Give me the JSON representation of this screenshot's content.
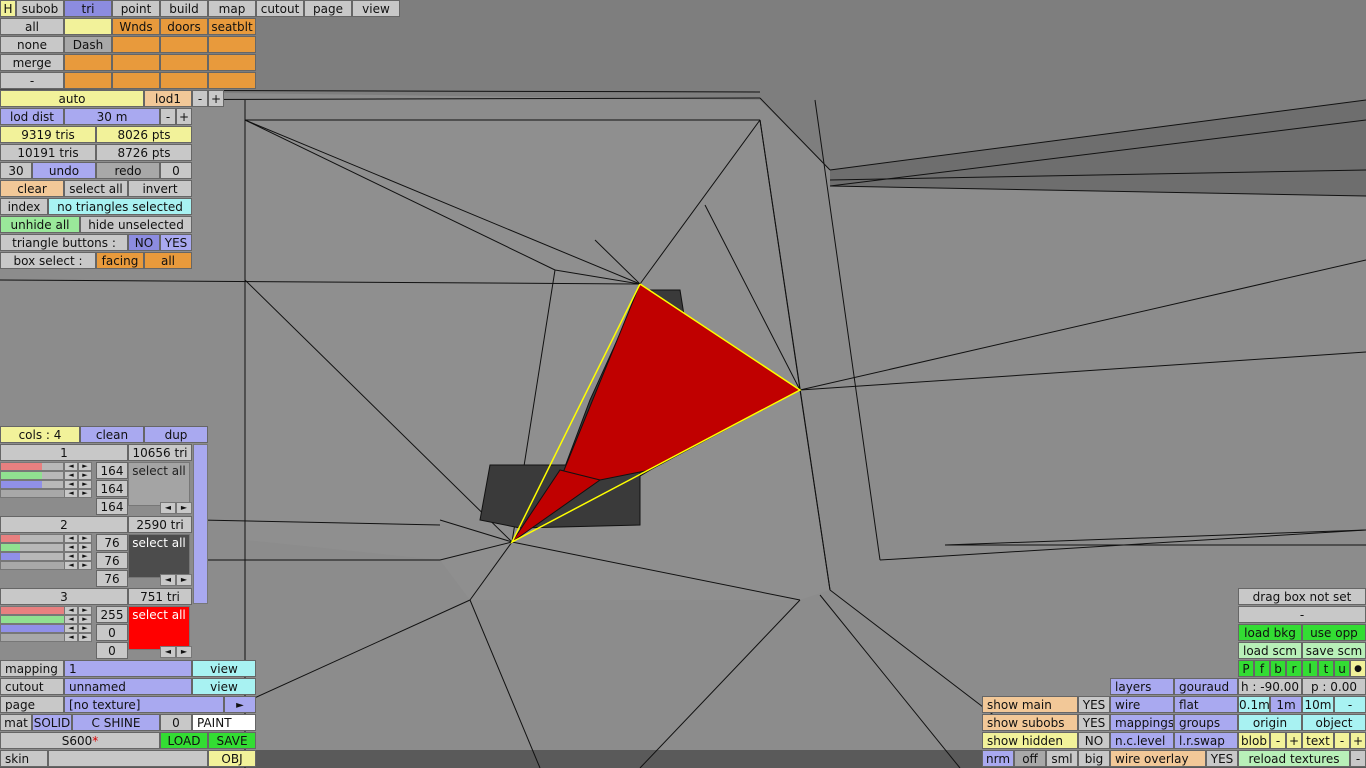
{
  "topbar": {
    "h": "H",
    "subob": "subob",
    "tri": "tri",
    "point": "point",
    "build": "build",
    "map": "map",
    "cutout": "cutout",
    "page": "page",
    "view": "view"
  },
  "subob": {
    "all": "all",
    "none": "none",
    "dash": "Dash",
    "merge": "merge",
    "minus": "-",
    "wnds": "Wnds",
    "doors": "doors",
    "seatblt": "seatblt"
  },
  "lod": {
    "auto": "auto",
    "lod1": "lod1",
    "minus": "-",
    "plus": "+",
    "dist_label": "lod dist",
    "dist_value": "30 m",
    "tris1": "9319 tris",
    "pts1": "8026 pts",
    "tris2": "10191 tris",
    "pts2": "8726 pts"
  },
  "edit": {
    "count": "30",
    "undo": "undo",
    "redo": "redo",
    "zero": "0",
    "clear": "clear",
    "select_all": "select all",
    "invert": "invert",
    "index": "index",
    "status": "no triangles selected",
    "unhide_all": "unhide all",
    "hide_unselected": "hide unselected",
    "tri_buttons": "triangle buttons :",
    "no": "NO",
    "yes": "YES",
    "box_select": "box select :",
    "facing": "facing",
    "all": "all"
  },
  "cols": {
    "title": "cols : 4",
    "clean": "clean",
    "dup": "dup",
    "groups": [
      {
        "num": "1",
        "tris": "10656 tri",
        "r": "164",
        "g": "164",
        "b": "164",
        "select": "select all",
        "fill": 0.64,
        "swatch": "#a4a4a4"
      },
      {
        "num": "2",
        "tris": "2590 tri",
        "r": "76",
        "g": "76",
        "b": "76",
        "select": "select all",
        "fill": 0.3,
        "swatch": "#4c4c4c"
      },
      {
        "num": "3",
        "tris": "751 tri",
        "r": "255",
        "g": "0",
        "b": "0",
        "select": "select all",
        "fill": 1.0,
        "swatch": "#ff0000"
      }
    ],
    "arrow_left": "◄",
    "arrow_right": "►"
  },
  "props": {
    "mapping": "mapping",
    "mapping_val": "1",
    "view": "view",
    "cutout": "cutout",
    "cutout_val": "unnamed",
    "page": "page",
    "page_val": "[no texture]",
    "play": "►",
    "mat": "mat",
    "solid": "SOLID",
    "cshine": "C SHINE",
    "zero": "0",
    "paint": "PAINT",
    "name": "S600",
    "star": "*",
    "load": "LOAD",
    "save": "SAVE",
    "skin": "skin",
    "obj": "OBJ"
  },
  "bottom": {
    "show_main": "show main",
    "yes1": "YES",
    "show_subobs": "show subobs",
    "yes2": "YES",
    "show_hidden": "show hidden",
    "no": "NO",
    "nrm": "nrm",
    "off": "off",
    "sml": "sml",
    "big": "big",
    "layers": "layers",
    "gouraud": "gouraud",
    "wire": "wire",
    "flat": "flat",
    "mappings": "mappings",
    "groups": "groups",
    "nclevel": "n.c.level",
    "lrswap": "l.r.swap",
    "wire_overlay": "wire overlay",
    "yes3": "YES"
  },
  "right": {
    "drag_box": "drag box not set",
    "dash": "-",
    "load_bkg": "load bkg",
    "use_opp": "use opp",
    "load_scm": "load scm",
    "save_scm": "save scm",
    "letters": [
      "P",
      "f",
      "b",
      "r",
      "l",
      "t",
      "u"
    ],
    "dot": "●",
    "h": "h : -90.00",
    "p": "p : 0.00",
    "m01": "0.1m",
    "m1": "1m",
    "m10": "10m",
    "minus": "-",
    "origin": "origin",
    "object": "object",
    "blob": "blob",
    "text": "text",
    "plus": "+",
    "reload": "reload textures"
  },
  "colors": {
    "viewport_bg": "#8a8a8a",
    "selection_red": "#c00000",
    "selection_edge": "#ffff00",
    "seat": "#3a3a3a"
  }
}
